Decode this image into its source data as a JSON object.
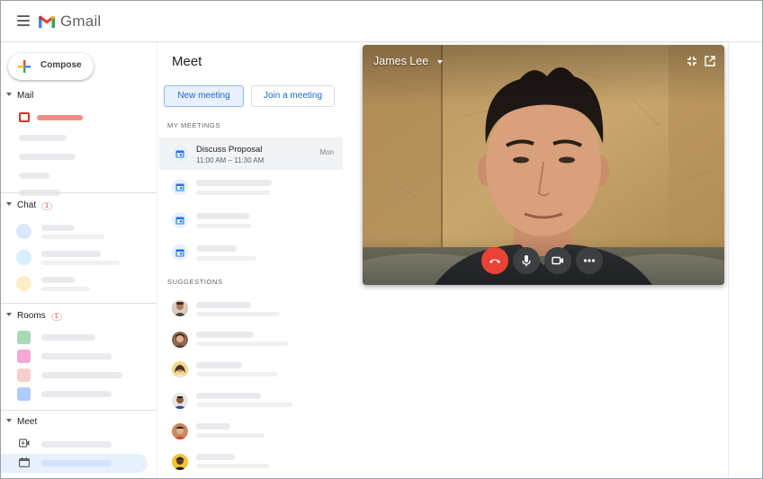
{
  "header": {
    "app_name": "Gmail"
  },
  "nav": {
    "compose_label": "Compose",
    "sections": {
      "mail": "Mail",
      "chat": "Chat",
      "chat_count": "1",
      "rooms": "Rooms",
      "rooms_count": "1",
      "meet": "Meet"
    }
  },
  "meet": {
    "title": "Meet",
    "new_meeting_label": "New meeting",
    "join_meeting_label": "Join a meeting",
    "my_meetings_label": "MY MEETINGS",
    "suggestions_label": "SUGGESTIONS",
    "first_meeting": {
      "title": "Discuss Proposal",
      "time": "11:00 AM – 11:30 AM",
      "day": "Mon"
    }
  },
  "call": {
    "caller_name": "James Lee"
  },
  "colors": {
    "accent_blue": "#1967d2",
    "end_call_red": "#ea4335",
    "badge_red": "#d93025",
    "control_dark": "#3c4043"
  },
  "icons": [
    "menu-icon",
    "gmail-logo-icon",
    "compose-plus-icon",
    "inbox-icon",
    "calendar-icon",
    "video-camera-icon",
    "keyboard-icon",
    "minimize-icon",
    "pop-out-icon",
    "end-call-icon",
    "microphone-icon",
    "camera-icon",
    "more-options-icon"
  ]
}
